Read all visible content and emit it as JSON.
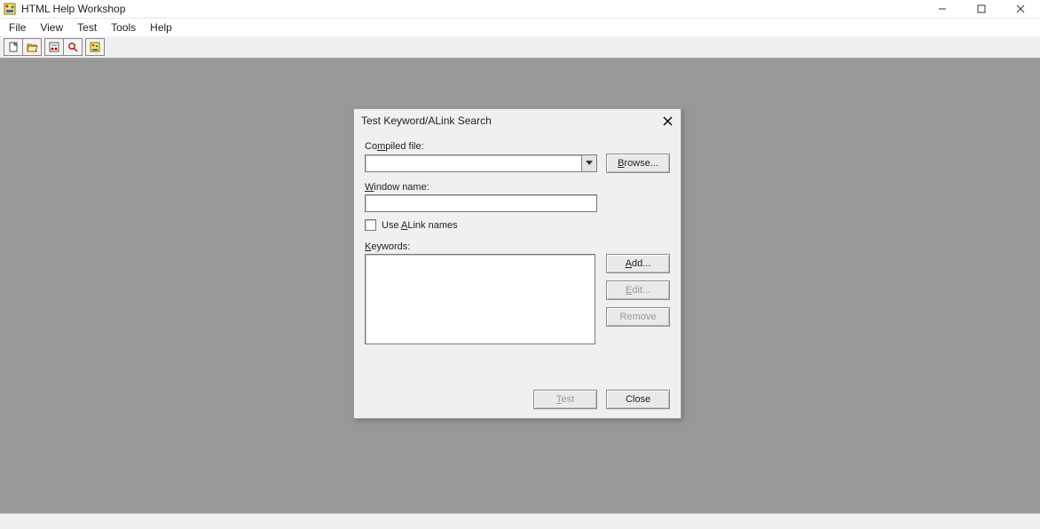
{
  "app": {
    "title": "HTML Help Workshop"
  },
  "menu": {
    "file": "File",
    "view": "View",
    "test": "Test",
    "tools": "Tools",
    "help": "Help"
  },
  "dialog": {
    "title": "Test Keyword/ALink Search",
    "compiled_label_pre": "Co",
    "compiled_label_u": "m",
    "compiled_label_post": "piled file:",
    "compiled_value": "",
    "browse_u": "B",
    "browse_post": "rowse...",
    "window_label_u": "W",
    "window_label_post": "indow name:",
    "window_value": "",
    "alink_pre": "Use ",
    "alink_u": "A",
    "alink_post": "Link names",
    "keywords_label_u": "K",
    "keywords_label_post": "eywords:",
    "add_u": "A",
    "add_post": "dd...",
    "edit_u": "E",
    "edit_post": "dit...",
    "remove": "Remove",
    "test_u": "T",
    "test_post": "est",
    "close": "Close"
  }
}
